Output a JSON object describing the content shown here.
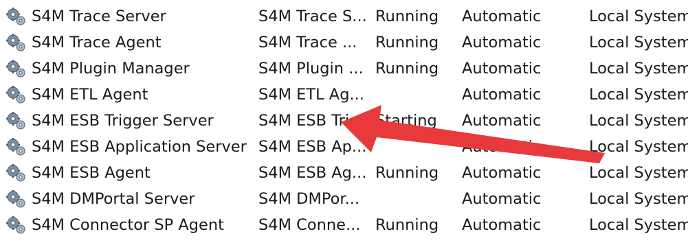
{
  "services": [
    {
      "name": "S4M Trace Server",
      "description": "S4M Trace S...",
      "status": "Running",
      "startup_type": "Automatic",
      "log_on_as": "Local System",
      "icon": "service-gear-icon"
    },
    {
      "name": "S4M Trace Agent",
      "description": "S4M Trace ...",
      "status": "Running",
      "startup_type": "Automatic",
      "log_on_as": "Local System",
      "icon": "service-gear-icon"
    },
    {
      "name": "S4M Plugin Manager",
      "description": "S4M Plugin ...",
      "status": "Running",
      "startup_type": "Automatic",
      "log_on_as": "Local System",
      "icon": "service-gear-icon"
    },
    {
      "name": "S4M ETL Agent",
      "description": "S4M ETL Ag...",
      "status": "",
      "startup_type": "Automatic",
      "log_on_as": "Local System",
      "icon": "service-gear-icon"
    },
    {
      "name": "S4M ESB Trigger Server",
      "description": "S4M ESB Tri...",
      "status": "Starting",
      "startup_type": "Automatic",
      "log_on_as": "Local System",
      "icon": "service-gear-icon"
    },
    {
      "name": "S4M ESB Application Server",
      "description": "S4M ESB Ap...",
      "status": "",
      "startup_type": "Automatic",
      "log_on_as": "Local System",
      "icon": "service-gear-icon"
    },
    {
      "name": "S4M ESB Agent",
      "description": "S4M ESB Ag...",
      "status": "Running",
      "startup_type": "Automatic",
      "log_on_as": "Local System",
      "icon": "service-gear-icon"
    },
    {
      "name": "S4M DMPortal Server",
      "description": "S4M DMPor...",
      "status": "",
      "startup_type": "Automatic",
      "log_on_as": "Local System",
      "icon": "service-gear-icon"
    },
    {
      "name": "S4M Connector SP Agent",
      "description": "S4M Conne...",
      "status": "Running",
      "startup_type": "Automatic",
      "log_on_as": "Local System",
      "icon": "service-gear-icon"
    }
  ],
  "annotation": {
    "icon": "red-arrow-icon",
    "color": "#e8393c"
  }
}
